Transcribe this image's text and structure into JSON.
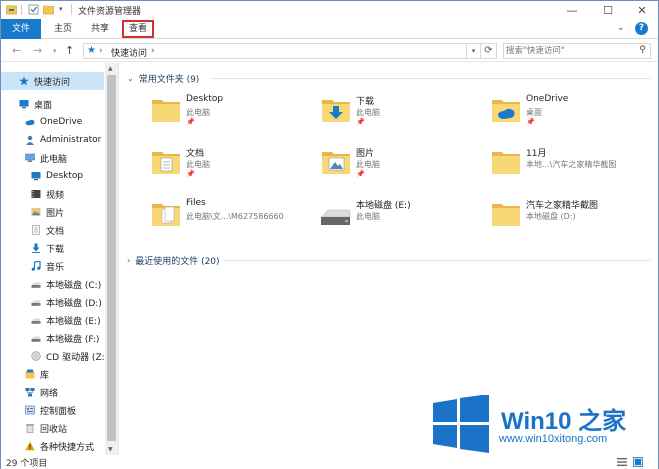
{
  "titlebar": {
    "title": "文件资源管理器",
    "dropdown_arrow": "▾",
    "buttons": {
      "minimize": "—",
      "maximize": "☐",
      "close": "✕"
    }
  },
  "ribbon": {
    "tabs": {
      "file": "文件",
      "home": "主页",
      "share": "共享",
      "view": "查看"
    },
    "collapse": "⌄",
    "help": "?"
  },
  "nav": {
    "back": "←",
    "forward": "→",
    "recent": "▾",
    "up": "↑",
    "address": {
      "star": "★",
      "sep": "›",
      "location": "快速访问"
    },
    "address_dropdown": "▾",
    "refresh": "⟳",
    "search_placeholder": "搜索\"快速访问\"",
    "search_icon": "⚲"
  },
  "sidebar": {
    "scroll_up": "▲",
    "scroll_down": "▼",
    "items": [
      {
        "label": "快速访问",
        "icon": "star-icon",
        "color": "#1979ca"
      },
      {
        "label": "桌面",
        "icon": "desktop-icon",
        "color": "#1979ca"
      },
      {
        "label": "OneDrive",
        "icon": "onedrive-icon",
        "color": "#1979ca"
      },
      {
        "label": "Administrator",
        "icon": "user-icon",
        "color": "#4a7bb5"
      },
      {
        "label": "此电脑",
        "icon": "computer-icon",
        "color": "#6aa6dd"
      },
      {
        "label": "Desktop",
        "icon": "desktop-icon",
        "color": "#1979ca"
      },
      {
        "label": "视频",
        "icon": "video-icon",
        "color": "#555"
      },
      {
        "label": "图片",
        "icon": "pictures-icon",
        "color": "#d9a740"
      },
      {
        "label": "文档",
        "icon": "documents-icon",
        "color": "#999"
      },
      {
        "label": "下载",
        "icon": "download-icon",
        "color": "#1979ca"
      },
      {
        "label": "音乐",
        "icon": "music-icon",
        "color": "#1979ca"
      },
      {
        "label": "本地磁盘 (C:)",
        "icon": "drive-icon",
        "color": "#777"
      },
      {
        "label": "本地磁盘 (D:)",
        "icon": "drive-icon",
        "color": "#777"
      },
      {
        "label": "本地磁盘 (E:)",
        "icon": "drive-icon",
        "color": "#777"
      },
      {
        "label": "本地磁盘 (F:)",
        "icon": "drive-icon",
        "color": "#777"
      },
      {
        "label": "CD 驱动器 (Z:)",
        "icon": "cd-drive-icon",
        "color": "#888"
      },
      {
        "label": "库",
        "icon": "library-icon",
        "color": "#1979ca"
      },
      {
        "label": "网络",
        "icon": "network-icon",
        "color": "#1979ca"
      },
      {
        "label": "控制面板",
        "icon": "control-panel-icon",
        "color": "#3a6fb0"
      },
      {
        "label": "回收站",
        "icon": "recycle-bin-icon",
        "color": "#888"
      },
      {
        "label": "各种快捷方式",
        "icon": "warning-folder-icon",
        "color": "#e0a800"
      }
    ]
  },
  "main": {
    "frequent": {
      "chevron": "⌄",
      "title": "常用文件夹 (9)",
      "items": [
        {
          "name": "Desktop",
          "sub": "此电脑",
          "pin": "📌",
          "icon": "folder-icon"
        },
        {
          "name": "下载",
          "sub": "此电脑",
          "pin": "📌",
          "icon": "downloads-folder-icon"
        },
        {
          "name": "OneDrive",
          "sub": "桌面",
          "pin": "📌",
          "icon": "onedrive-folder-icon"
        },
        {
          "name": "文档",
          "sub": "此电脑",
          "pin": "📌",
          "icon": "documents-folder-icon"
        },
        {
          "name": "图片",
          "sub": "此电脑",
          "pin": "📌",
          "icon": "pictures-folder-icon"
        },
        {
          "name": "11月",
          "sub": "本地...\\汽车之家精华截图",
          "pin": "",
          "icon": "folder-icon"
        },
        {
          "name": "Files",
          "sub": "此电脑\\文...\\M627586660",
          "pin": "",
          "icon": "files-folder-icon"
        },
        {
          "name": "本地磁盘 (E:)",
          "sub": "此电脑",
          "pin": "",
          "icon": "drive-icon"
        },
        {
          "name": "汽车之家精华截图",
          "sub": "本地磁盘 (D:)",
          "pin": "",
          "icon": "folder-icon"
        }
      ]
    },
    "recent": {
      "chevron": "›",
      "title": "最近使用的文件 (20)"
    }
  },
  "status": {
    "count": "29 个项目"
  },
  "watermark": {
    "brand": "Win10 之家",
    "url": "www.win10xitong.com"
  }
}
